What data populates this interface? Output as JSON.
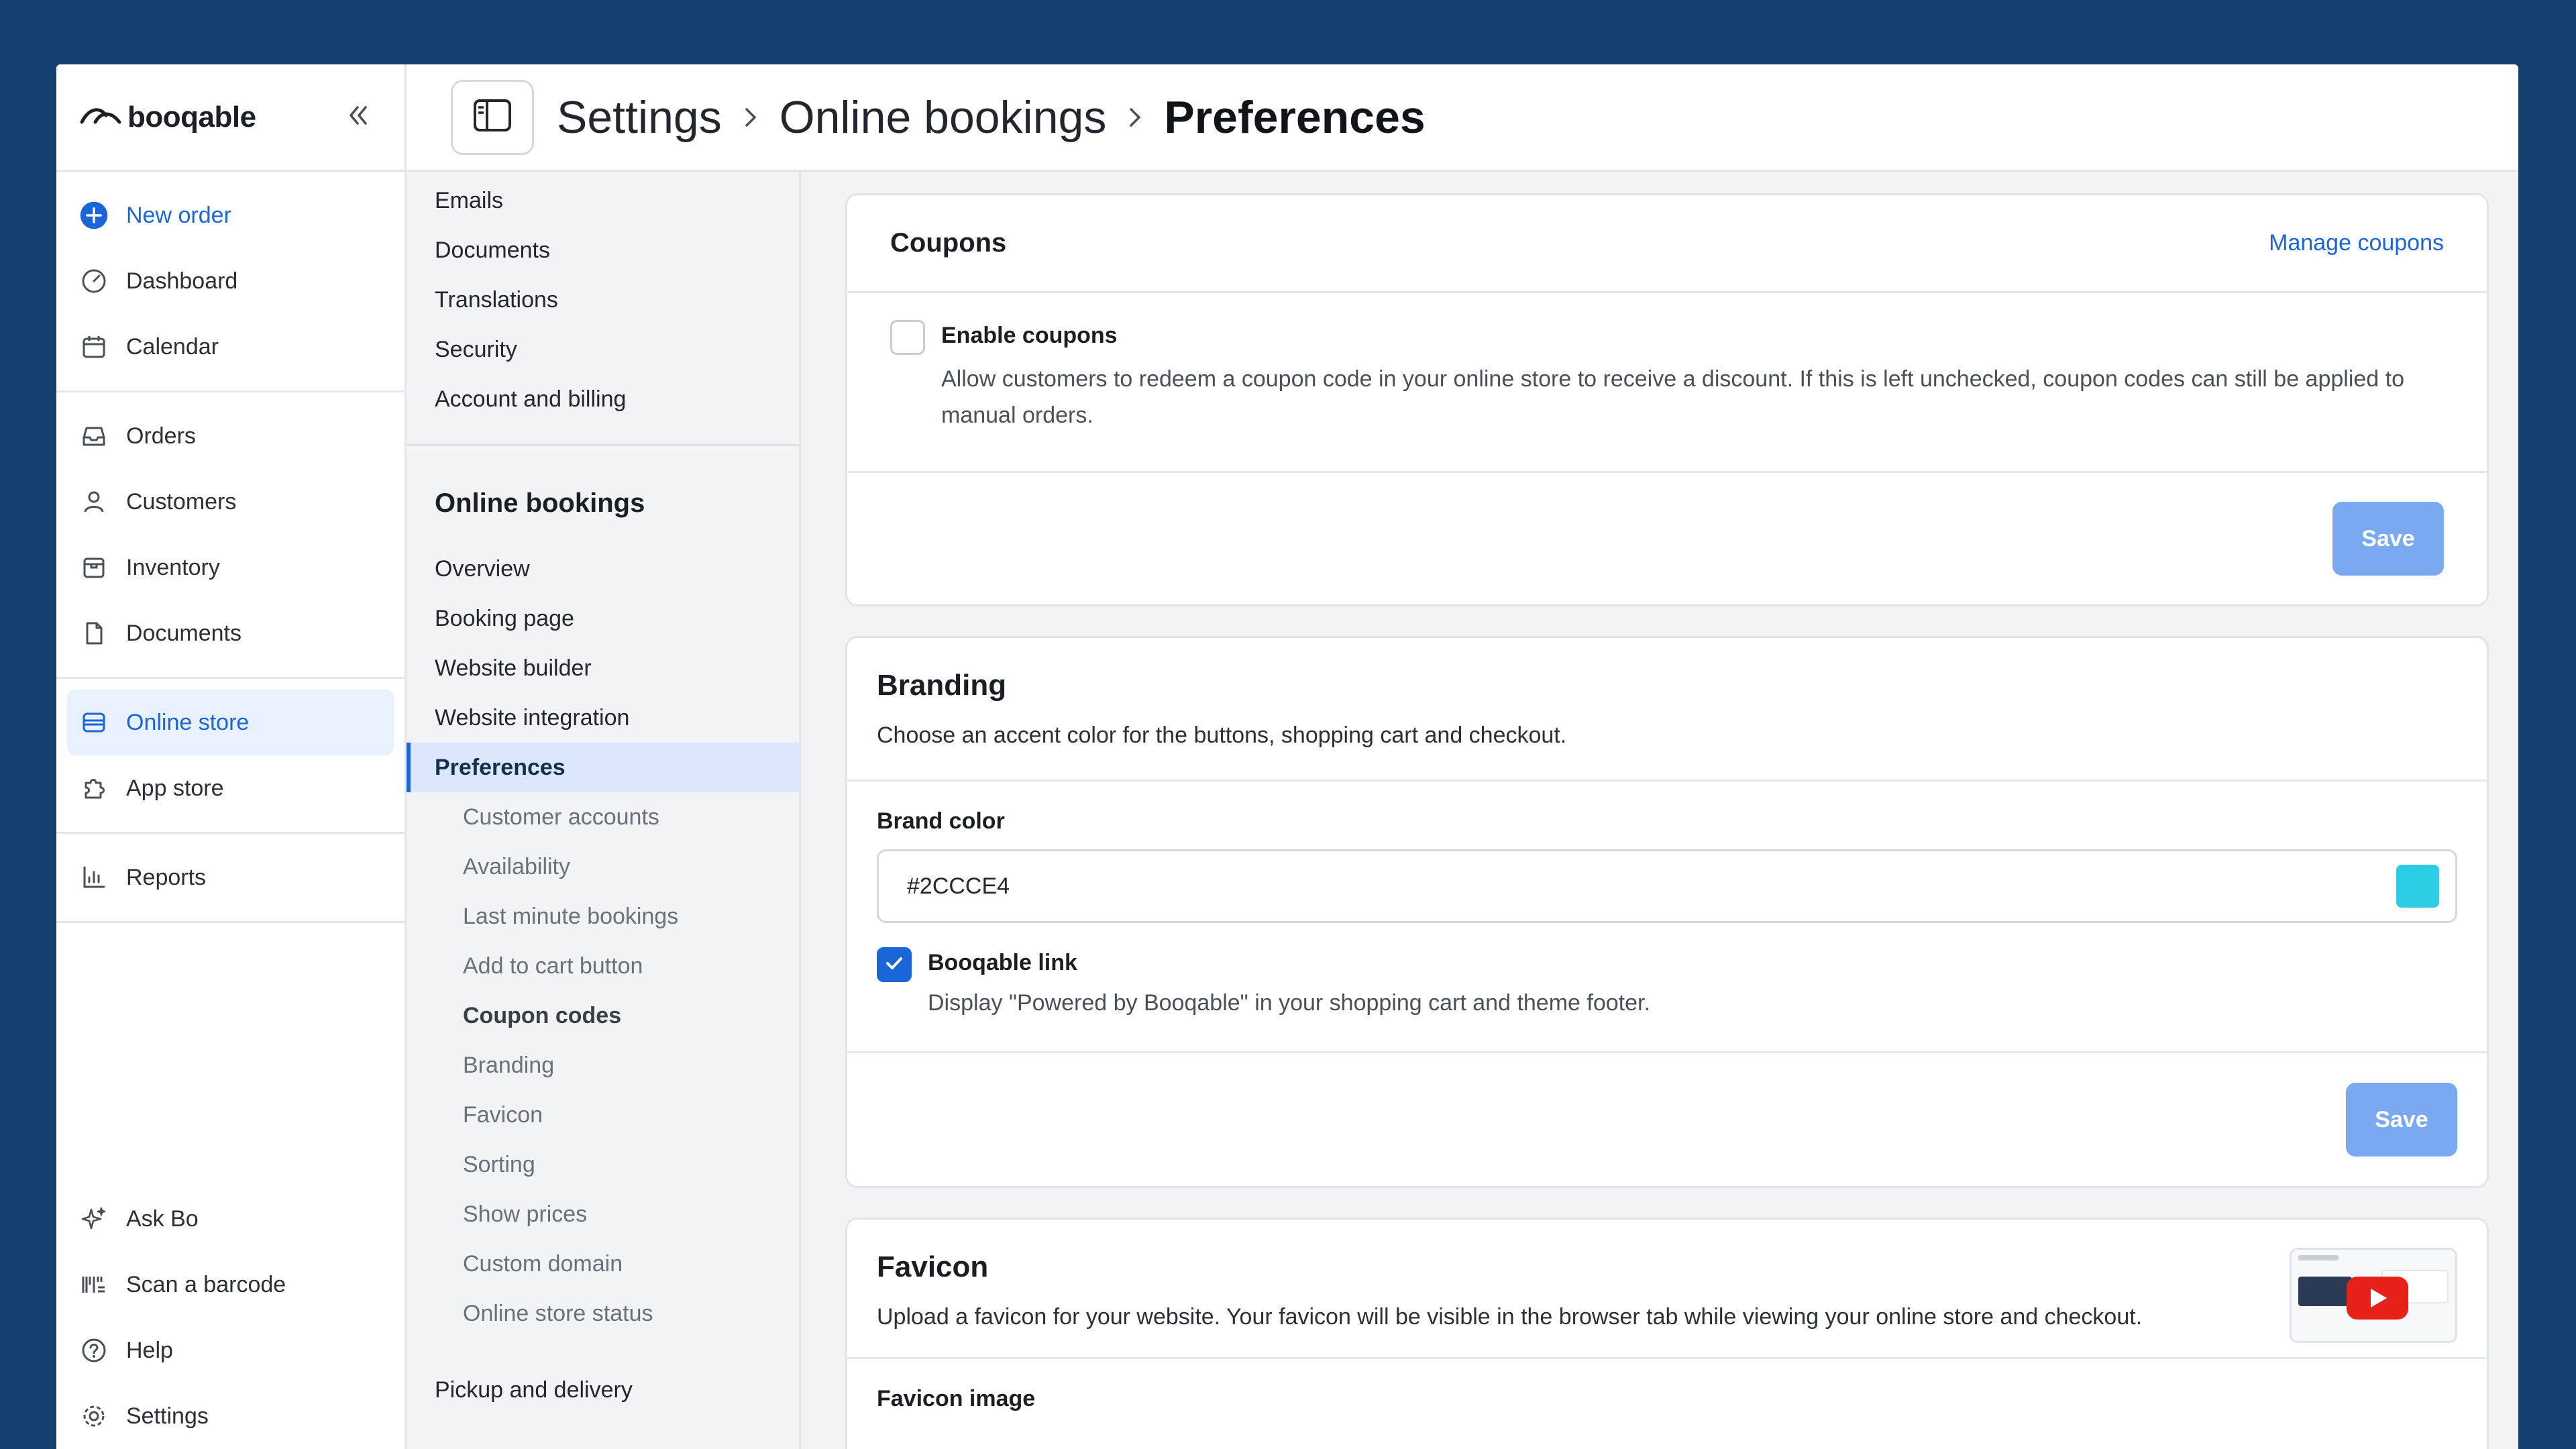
{
  "nav": {
    "logo_text": "booqable",
    "top_items": [
      {
        "label": "New order",
        "icon": "plus-circle-icon"
      },
      {
        "label": "Dashboard",
        "icon": "gauge-icon"
      },
      {
        "label": "Calendar",
        "icon": "calendar-icon"
      }
    ],
    "mid_items": [
      {
        "label": "Orders",
        "icon": "inbox-icon"
      },
      {
        "label": "Customers",
        "icon": "user-icon"
      },
      {
        "label": "Inventory",
        "icon": "box-icon"
      },
      {
        "label": "Documents",
        "icon": "file-icon"
      }
    ],
    "store_items": [
      {
        "label": "Online store",
        "icon": "store-icon"
      },
      {
        "label": "App store",
        "icon": "puzzle-icon"
      }
    ],
    "report_items": [
      {
        "label": "Reports",
        "icon": "chart-icon"
      }
    ],
    "bottom_items": [
      {
        "label": "Ask Bo",
        "icon": "sparkle-icon"
      },
      {
        "label": "Scan a barcode",
        "icon": "barcode-icon"
      },
      {
        "label": "Help",
        "icon": "help-icon"
      },
      {
        "label": "Settings",
        "icon": "gear-icon"
      }
    ]
  },
  "header": {
    "crumb_1": "Settings",
    "crumb_2": "Online bookings",
    "crumb_3": "Preferences"
  },
  "subnav": {
    "top_items": [
      "Emails",
      "Documents",
      "Translations",
      "Security",
      "Account and billing"
    ],
    "heading": "Online bookings",
    "items": [
      "Overview",
      "Booking page",
      "Website builder",
      "Website integration"
    ],
    "selected": "Preferences",
    "children": [
      "Customer accounts",
      "Availability",
      "Last minute bookings",
      "Add to cart button",
      "Coupon codes",
      "Branding",
      "Favicon",
      "Sorting",
      "Show prices",
      "Custom domain",
      "Online store status"
    ],
    "next_section": "Pickup and delivery"
  },
  "coupons": {
    "title": "Coupons",
    "manage_link": "Manage coupons",
    "enable_label": "Enable coupons",
    "enable_desc": "Allow customers to redeem a coupon code in your online store to receive a discount. If this is left unchecked, coupon codes can still be applied to manual orders.",
    "save_label": "Save"
  },
  "branding": {
    "title": "Branding",
    "desc": "Choose an accent color for the buttons, shopping cart and checkout.",
    "brand_color_label": "Brand color",
    "brand_color_value": "#2CCCE4",
    "booqable_link_label": "Booqable link",
    "booqable_link_desc": "Display \"Powered by Booqable\" in your shopping cart and theme footer.",
    "save_label": "Save"
  },
  "favicon": {
    "title": "Favicon",
    "desc": "Upload a favicon for your website. Your favicon will be visible in the browser tab while viewing your online store and checkout.",
    "image_label": "Favicon image"
  },
  "colors": {
    "accent": "#1a66d8",
    "brand_swatch": "#2CCCE4"
  }
}
